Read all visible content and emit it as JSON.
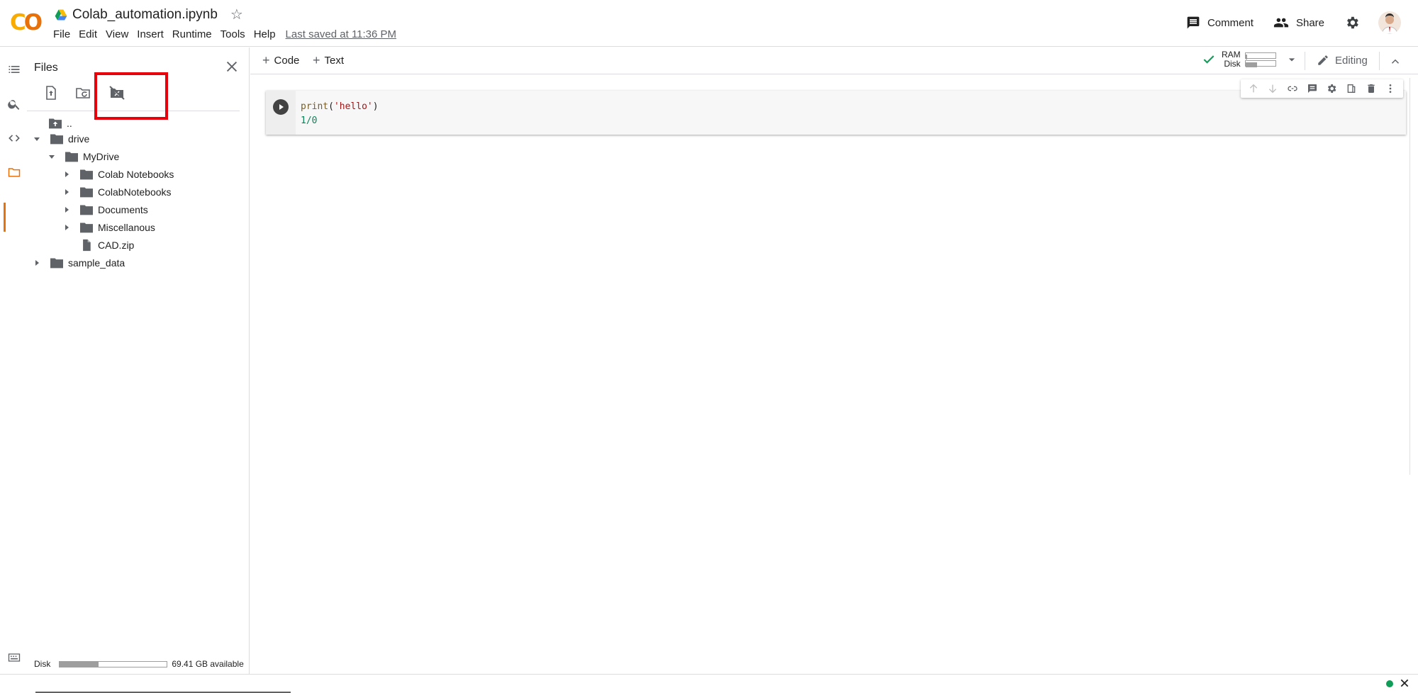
{
  "header": {
    "logo": "CO",
    "doc_title": "Colab_automation.ipynb",
    "menu": [
      "File",
      "Edit",
      "View",
      "Insert",
      "Runtime",
      "Tools",
      "Help"
    ],
    "last_saved": "Last saved at 11:36 PM",
    "comment_label": "Comment",
    "share_label": "Share"
  },
  "sidebar": {
    "panel_title": "Files",
    "tree": [
      {
        "name": "..",
        "type": "parent"
      },
      {
        "name": "drive",
        "type": "folder",
        "expanded": true
      },
      {
        "name": "MyDrive",
        "type": "folder",
        "expanded": true
      },
      {
        "name": "Colab Notebooks",
        "type": "folder",
        "expanded": false
      },
      {
        "name": "ColabNotebooks",
        "type": "folder",
        "expanded": false
      },
      {
        "name": "Documents",
        "type": "folder",
        "expanded": false
      },
      {
        "name": "Miscellanous",
        "type": "folder",
        "expanded": false
      },
      {
        "name": "CAD.zip",
        "type": "file"
      },
      {
        "name": "sample_data",
        "type": "folder",
        "expanded": false
      }
    ],
    "disk_label": "Disk",
    "disk_available": "69.41 GB available",
    "disk_used_fraction": 0.36
  },
  "toolbar": {
    "add_code_label": "Code",
    "add_text_label": "Text",
    "ram_label": "RAM",
    "disk_label": "Disk",
    "ram_used_fraction": 0.06,
    "disk_used_fraction": 0.38,
    "editing_label": "Editing"
  },
  "cell": {
    "line1": {
      "fn": "print",
      "open": "(",
      "str": "'hello'",
      "close": ")"
    },
    "line2": "1/0"
  },
  "colors": {
    "accent": "#e8710a",
    "logo_yellow": "#f9ab00",
    "highlight_box": "#e8000b",
    "connected": "#0f9d58"
  }
}
